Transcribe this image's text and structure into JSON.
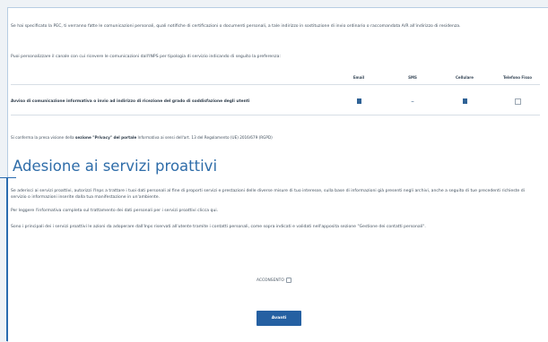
{
  "intro": {
    "paragraph": "Se hai specificato la PEC, ti verranno fatte le comunicazioni personali, quali notifiche di certificazioni o documenti personali, a tale indirizzo in sostituzione di invio ordinario o raccomandata A/R all'indirizzo di residenza.",
    "prefs_text": "Puoi personalizzare il canale con cui ricevere le comunicazioni dall'INPS per tipologia di servizio indicando di seguito la preferenza:"
  },
  "prefs_table": {
    "columns": [
      "Email",
      "SMS",
      "Cellulare",
      "Telefono Fisso"
    ],
    "row_label": "Avviso di comunicazione informativa o invio ad indirizzo di ricezione del grado di soddisfazione degli utenti",
    "cells": [
      "check",
      "dash",
      "check",
      "empty"
    ]
  },
  "privacy_note": {
    "before": "Si conferma la presa visione della ",
    "bold": "sezione \"Privacy\" del portale",
    "after": " Informativa ai sensi dell'art. 13 del Regolamento (UE) 2016/679 (RGPD)"
  },
  "proactive": {
    "title": "Adesione ai servizi proattivi",
    "paragraph1": "Se aderisci ai servizi proattivi, autorizzi l'Inps a trattare i tuoi dati personali al fine di proporti servizi e prestazioni delle diverse misure di tuo interesse, sulla base di informazioni già presenti negli archivi, anche a seguito di tue precedenti richieste di servizio o informazioni inserite dalla tua manifestazione in un'ambiente.",
    "paragraph2": "Per leggere l'informativa completa sul trattamento dei dati personali per i servizi proattivi clicca qui.",
    "paragraph3": "Sono i principali dei i servizi proattivi le azioni da adoperare dall'Inps riservati all'utente tramite i contatti personali, come sopra indicati e validati nell'apposita sezione \"Gestione dei contatti personali\".",
    "accept_label": "ACCONSENTO",
    "submit_label": "Avanti"
  }
}
